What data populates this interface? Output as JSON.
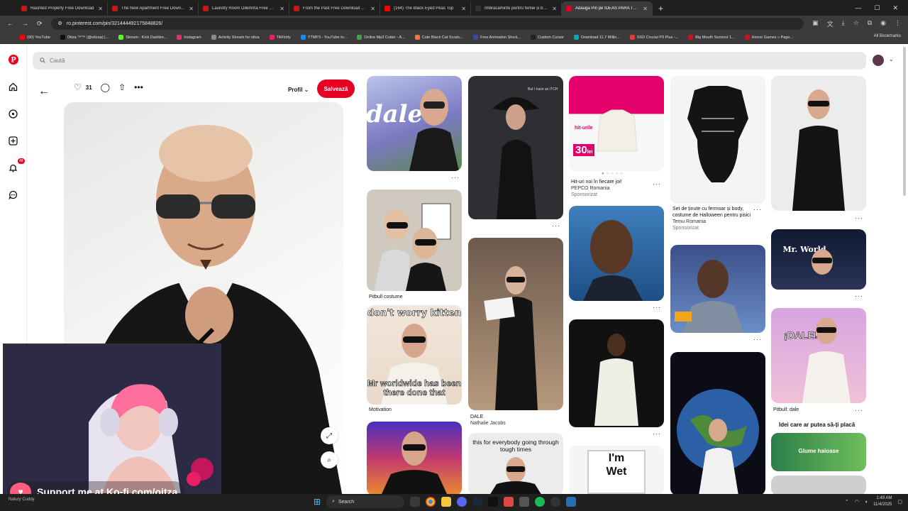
{
  "tabs": [
    {
      "label": "Haunted Property Free Download",
      "color": "#c4161c"
    },
    {
      "label": "The New Apartment Free Download",
      "color": "#c4161c"
    },
    {
      "label": "Laundry Room Dilemma Free Dow...",
      "color": "#c4161c"
    },
    {
      "label": "From the Past Free Download » St...",
      "color": "#c4161c"
    },
    {
      "label": "(164) The Black Eyed Peas Top",
      "color": "#ff0000"
    },
    {
      "label": "Îmbrăcăminte pentru femei și băr...",
      "color": "#333333"
    },
    {
      "label": "Adaugă Pin pe IDEAS PARA TU DI...",
      "color": "#e60023",
      "active": true
    }
  ],
  "address": {
    "url": "ro.pinterest.com/pin/321444492175848826/"
  },
  "bookmarks": [
    {
      "label": "(90) YouTube",
      "color": "#ff0000"
    },
    {
      "label": "Oitza ™™ (@oitzaa) |...",
      "color": "#111111"
    },
    {
      "label": "Stream - Kick Dashbo...",
      "color": "#53fc18"
    },
    {
      "label": "Instagram",
      "color": "#e1306c"
    },
    {
      "label": "Activity Stream for oitza",
      "color": "#888888"
    },
    {
      "label": "TikFinity",
      "color": "#e91e63"
    },
    {
      "label": "YTMP3 - YouTube to...",
      "color": "#1e88e5"
    },
    {
      "label": "Online Mp3 Cutter - A...",
      "color": "#43a047"
    },
    {
      "label": "Cute Black Cat Scratc...",
      "color": "#ff7043"
    },
    {
      "label": "Free Animation Stock...",
      "color": "#3949ab"
    },
    {
      "label": "Custom Cursor",
      "color": "#222222"
    },
    {
      "label": "Download 11.7 Millio...",
      "color": "#00acc1"
    },
    {
      "label": "SSD Crucial P3 Plus -...",
      "color": "#e53935"
    },
    {
      "label": "Big Mouth Sezonul 1...",
      "color": "#c4161c"
    },
    {
      "label": "Horror Games » Page...",
      "color": "#c4161c"
    }
  ],
  "all_bookmarks": "All Bookmarks",
  "search": {
    "placeholder": "Caută"
  },
  "sidebar": {
    "notif_count": "48"
  },
  "pin": {
    "likes": "31",
    "profile": "Profil",
    "save": "Salvează"
  },
  "grid": {
    "dale_text": "dale",
    "pitbull_costume": "Pitbull costume",
    "dont_worry_top": "don't worry kitten",
    "dont_worry_bottom": "Mr worldwide has been there done that",
    "motivation": "Motivation",
    "cowboy_caption": "But I have an ITCH",
    "dale_caption": "DALE",
    "dale_author": "Nathalie Jacobs",
    "tough_times": "this for everybody going through tough times",
    "ad_title": "Hit-uri noi în fiecare joi!",
    "ad_brand": "PEPCO Romania",
    "ad_sponsored": "Sponsorizat",
    "ad_hit": "hit-urile",
    "ad_price": "30",
    "ad_currency": "lei",
    "im_wet": "I'm Wet",
    "temu_title": "Set de ținute cu fermoar și body, costume de Halloween pentru pisici",
    "temu_brand": "Temu Romania",
    "temu_sponsored": "Sponsorizat",
    "mr_world": "Mr. World",
    "dale_big": "¡DALE!",
    "pitbull_dale": "Pitbull: dale",
    "ideas_title": "Idei care ar putea să-ți placă",
    "glume": "Glume haioase"
  },
  "overlay": {
    "kofi": "Support me at Ko-fi.com/oitza",
    "watermark": "Natury Cuddy"
  },
  "taskbar": {
    "search": "Search",
    "time": "1:49 AM",
    "date": "11/4/2025"
  }
}
